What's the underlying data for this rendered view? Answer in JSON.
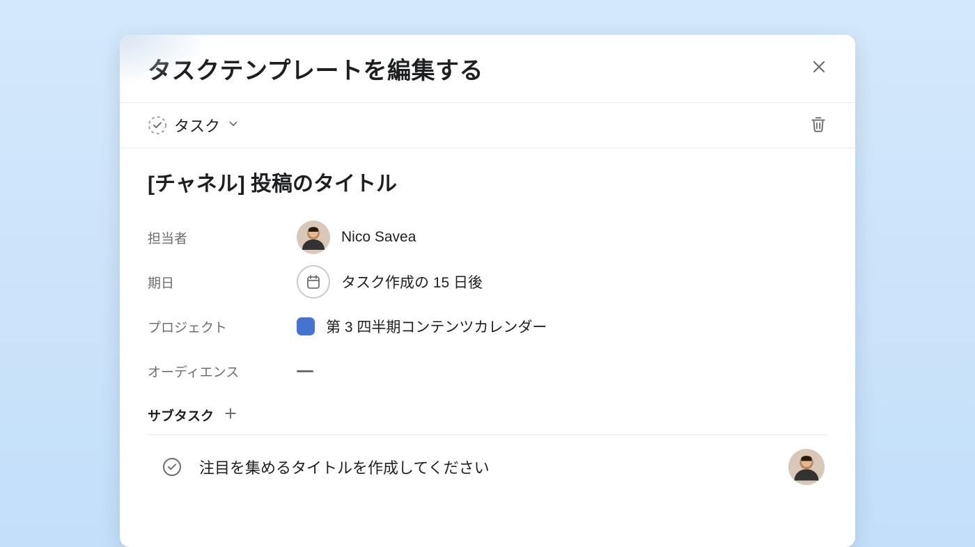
{
  "header": {
    "title": "タスクテンプレートを編集する"
  },
  "toolbar": {
    "taskTypeLabel": "タスク"
  },
  "task": {
    "title": "[チャネル] 投稿のタイトル"
  },
  "fields": {
    "assignee": {
      "label": "担当者",
      "value": "Nico Savea"
    },
    "dueDate": {
      "label": "期日",
      "value": "タスク作成の 15 日後"
    },
    "project": {
      "label": "プロジェクト",
      "value": "第 3 四半期コンテンツカレンダー",
      "color": "#4573d2"
    },
    "audience": {
      "label": "オーディエンス",
      "value": "—"
    }
  },
  "subtasks": {
    "label": "サブタスク",
    "items": [
      {
        "title": "注目を集めるタイトルを作成してください"
      }
    ]
  }
}
